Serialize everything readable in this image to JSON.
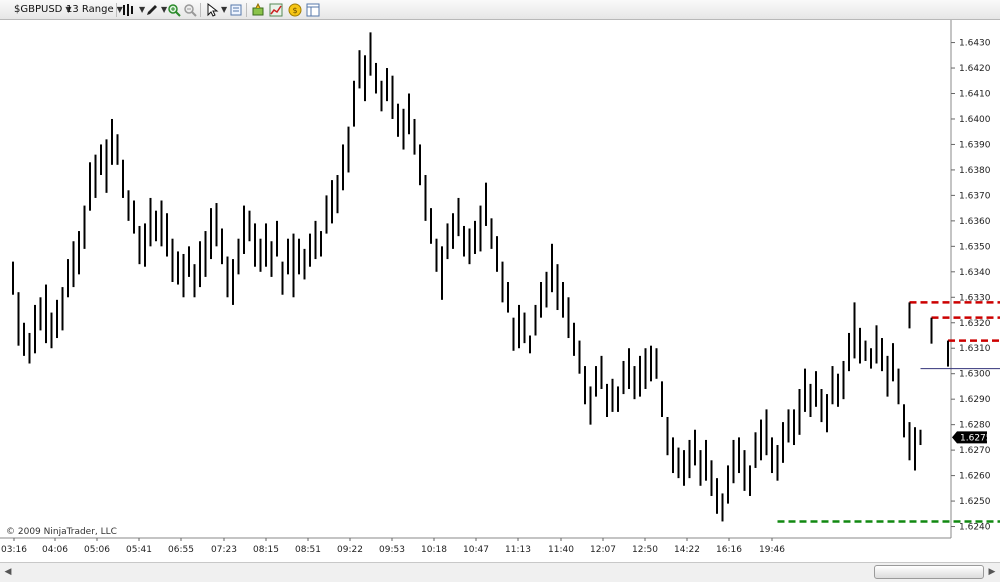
{
  "toolbar": {
    "instrument": "$GBPUSD",
    "period": "13 Range",
    "icons": [
      "bar-style-icon",
      "drawing-pencil-icon",
      "zoom-in-icon",
      "zoom-out-icon",
      "pointer-icon",
      "properties-icon",
      "strategy-icon",
      "chart-trader-icon",
      "alerts-icon",
      "data-box-icon"
    ]
  },
  "copyright": "© 2009 NinjaTrader, LLC",
  "colors": {
    "bars": "#000000",
    "resistance": "#cc0000",
    "support": "#118811",
    "pivot": "#33337a",
    "price_marker_bg": "#000000",
    "price_marker_text": "#ffffff"
  },
  "chart_data": {
    "type": "ohlc",
    "xlabels": [
      "03:16",
      "04:06",
      "05:06",
      "05:41",
      "06:55",
      "07:23",
      "08:15",
      "08:51",
      "09:22",
      "09:53",
      "10:18",
      "10:47",
      "11:13",
      "11:40",
      "12:07",
      "12:50",
      "14:22",
      "16:16",
      "19:46"
    ],
    "yticks": [
      1.624,
      1.625,
      1.626,
      1.627,
      1.628,
      1.629,
      1.63,
      1.631,
      1.632,
      1.633,
      1.634,
      1.635,
      1.636,
      1.637,
      1.638,
      1.639,
      1.64,
      1.641,
      1.642,
      1.643
    ],
    "ylim": [
      1.62355,
      1.64365
    ],
    "last_price": "1.6275",
    "bars": [
      {
        "h": 1.6344,
        "l": 1.6331
      },
      {
        "h": 1.6332,
        "l": 1.6311
      },
      {
        "h": 1.632,
        "l": 1.6307
      },
      {
        "h": 1.6316,
        "l": 1.6304
      },
      {
        "h": 1.6327,
        "l": 1.6308
      },
      {
        "h": 1.633,
        "l": 1.6317
      },
      {
        "h": 1.6335,
        "l": 1.6312
      },
      {
        "h": 1.6324,
        "l": 1.631
      },
      {
        "h": 1.6329,
        "l": 1.6314
      },
      {
        "h": 1.6334,
        "l": 1.6317
      },
      {
        "h": 1.6345,
        "l": 1.633
      },
      {
        "h": 1.6352,
        "l": 1.6334
      },
      {
        "h": 1.6356,
        "l": 1.6339
      },
      {
        "h": 1.6366,
        "l": 1.6349
      },
      {
        "h": 1.6383,
        "l": 1.6364
      },
      {
        "h": 1.6386,
        "l": 1.6369
      },
      {
        "h": 1.639,
        "l": 1.6378
      },
      {
        "h": 1.6392,
        "l": 1.6371
      },
      {
        "h": 1.64,
        "l": 1.6382
      },
      {
        "h": 1.6394,
        "l": 1.6382
      },
      {
        "h": 1.6384,
        "l": 1.6369
      },
      {
        "h": 1.6372,
        "l": 1.636
      },
      {
        "h": 1.6368,
        "l": 1.6355
      },
      {
        "h": 1.6358,
        "l": 1.6343
      },
      {
        "h": 1.6359,
        "l": 1.6342
      },
      {
        "h": 1.6369,
        "l": 1.635
      },
      {
        "h": 1.6364,
        "l": 1.6352
      },
      {
        "h": 1.6368,
        "l": 1.635
      },
      {
        "h": 1.6363,
        "l": 1.6346
      },
      {
        "h": 1.6353,
        "l": 1.6336
      },
      {
        "h": 1.6348,
        "l": 1.6335
      },
      {
        "h": 1.6347,
        "l": 1.633
      },
      {
        "h": 1.635,
        "l": 1.6338
      },
      {
        "h": 1.6343,
        "l": 1.633
      },
      {
        "h": 1.6352,
        "l": 1.6334
      },
      {
        "h": 1.6356,
        "l": 1.6338
      },
      {
        "h": 1.6365,
        "l": 1.6345
      },
      {
        "h": 1.6367,
        "l": 1.635
      },
      {
        "h": 1.6357,
        "l": 1.6343
      },
      {
        "h": 1.6346,
        "l": 1.633
      },
      {
        "h": 1.6345,
        "l": 1.6327
      },
      {
        "h": 1.6353,
        "l": 1.6339
      },
      {
        "h": 1.6366,
        "l": 1.6347
      },
      {
        "h": 1.6364,
        "l": 1.6352
      },
      {
        "h": 1.6359,
        "l": 1.6342
      },
      {
        "h": 1.6353,
        "l": 1.634
      },
      {
        "h": 1.6359,
        "l": 1.6342
      },
      {
        "h": 1.6352,
        "l": 1.6338
      },
      {
        "h": 1.636,
        "l": 1.6346
      },
      {
        "h": 1.6344,
        "l": 1.6331
      },
      {
        "h": 1.6353,
        "l": 1.6339
      },
      {
        "h": 1.6355,
        "l": 1.633
      },
      {
        "h": 1.6353,
        "l": 1.6339
      },
      {
        "h": 1.6349,
        "l": 1.6337
      },
      {
        "h": 1.6355,
        "l": 1.6342
      },
      {
        "h": 1.636,
        "l": 1.6345
      },
      {
        "h": 1.6356,
        "l": 1.6346
      },
      {
        "h": 1.637,
        "l": 1.6355
      },
      {
        "h": 1.6376,
        "l": 1.6359
      },
      {
        "h": 1.6378,
        "l": 1.6363
      },
      {
        "h": 1.639,
        "l": 1.6372
      },
      {
        "h": 1.6397,
        "l": 1.6379
      },
      {
        "h": 1.6415,
        "l": 1.6397
      },
      {
        "h": 1.6427,
        "l": 1.6412
      },
      {
        "h": 1.6425,
        "l": 1.6407
      },
      {
        "h": 1.6434,
        "l": 1.6417
      },
      {
        "h": 1.6422,
        "l": 1.641
      },
      {
        "h": 1.6415,
        "l": 1.6403
      },
      {
        "h": 1.642,
        "l": 1.6407
      },
      {
        "h": 1.6417,
        "l": 1.64
      },
      {
        "h": 1.6406,
        "l": 1.6393
      },
      {
        "h": 1.6404,
        "l": 1.6388
      },
      {
        "h": 1.641,
        "l": 1.6394
      },
      {
        "h": 1.64,
        "l": 1.6386
      },
      {
        "h": 1.639,
        "l": 1.6374
      },
      {
        "h": 1.6378,
        "l": 1.636
      },
      {
        "h": 1.6365,
        "l": 1.6351
      },
      {
        "h": 1.6353,
        "l": 1.634
      },
      {
        "h": 1.635,
        "l": 1.6329
      },
      {
        "h": 1.6359,
        "l": 1.6345
      },
      {
        "h": 1.6363,
        "l": 1.6349
      },
      {
        "h": 1.6369,
        "l": 1.6354
      },
      {
        "h": 1.6358,
        "l": 1.6346
      },
      {
        "h": 1.6357,
        "l": 1.6343
      },
      {
        "h": 1.636,
        "l": 1.6347
      },
      {
        "h": 1.6366,
        "l": 1.6348
      },
      {
        "h": 1.6375,
        "l": 1.6358
      },
      {
        "h": 1.6361,
        "l": 1.6349
      },
      {
        "h": 1.6354,
        "l": 1.634
      },
      {
        "h": 1.6344,
        "l": 1.6328
      },
      {
        "h": 1.6336,
        "l": 1.6324
      },
      {
        "h": 1.6322,
        "l": 1.6309
      },
      {
        "h": 1.6327,
        "l": 1.631
      },
      {
        "h": 1.6324,
        "l": 1.6312
      },
      {
        "h": 1.6315,
        "l": 1.6308
      },
      {
        "h": 1.6327,
        "l": 1.6315
      },
      {
        "h": 1.6336,
        "l": 1.6322
      },
      {
        "h": 1.634,
        "l": 1.6326
      },
      {
        "h": 1.6351,
        "l": 1.6332
      },
      {
        "h": 1.6343,
        "l": 1.6325
      },
      {
        "h": 1.6336,
        "l": 1.6322
      },
      {
        "h": 1.633,
        "l": 1.6314
      },
      {
        "h": 1.632,
        "l": 1.6307
      },
      {
        "h": 1.6313,
        "l": 1.63
      },
      {
        "h": 1.6303,
        "l": 1.6288
      },
      {
        "h": 1.6295,
        "l": 1.628
      },
      {
        "h": 1.6303,
        "l": 1.6291
      },
      {
        "h": 1.6307,
        "l": 1.6294
      },
      {
        "h": 1.6296,
        "l": 1.6283
      },
      {
        "h": 1.6298,
        "l": 1.6285
      },
      {
        "h": 1.6295,
        "l": 1.6285
      },
      {
        "h": 1.6305,
        "l": 1.6292
      },
      {
        "h": 1.631,
        "l": 1.6294
      },
      {
        "h": 1.6303,
        "l": 1.629
      },
      {
        "h": 1.6307,
        "l": 1.6291
      },
      {
        "h": 1.631,
        "l": 1.6294
      },
      {
        "h": 1.6311,
        "l": 1.6297
      },
      {
        "h": 1.631,
        "l": 1.6298
      },
      {
        "h": 1.6297,
        "l": 1.6283
      },
      {
        "h": 1.6283,
        "l": 1.6268
      },
      {
        "h": 1.6275,
        "l": 1.6261
      },
      {
        "h": 1.6271,
        "l": 1.6259
      },
      {
        "h": 1.627,
        "l": 1.6256
      },
      {
        "h": 1.6274,
        "l": 1.6259
      },
      {
        "h": 1.6278,
        "l": 1.6264
      },
      {
        "h": 1.627,
        "l": 1.6256
      },
      {
        "h": 1.6274,
        "l": 1.6258
      },
      {
        "h": 1.6266,
        "l": 1.6252
      },
      {
        "h": 1.6259,
        "l": 1.6245
      },
      {
        "h": 1.6253,
        "l": 1.6242
      },
      {
        "h": 1.6264,
        "l": 1.6249
      },
      {
        "h": 1.6274,
        "l": 1.6257
      },
      {
        "h": 1.6275,
        "l": 1.6261
      },
      {
        "h": 1.627,
        "l": 1.6254
      },
      {
        "h": 1.6264,
        "l": 1.6252
      },
      {
        "h": 1.6277,
        "l": 1.6263
      },
      {
        "h": 1.6282,
        "l": 1.6266
      },
      {
        "h": 1.6286,
        "l": 1.6268
      },
      {
        "h": 1.6275,
        "l": 1.6261
      },
      {
        "h": 1.6272,
        "l": 1.6258
      },
      {
        "h": 1.6281,
        "l": 1.6265
      },
      {
        "h": 1.6286,
        "l": 1.6273
      },
      {
        "h": 1.6286,
        "l": 1.6272
      },
      {
        "h": 1.6294,
        "l": 1.6276
      },
      {
        "h": 1.6302,
        "l": 1.6285
      },
      {
        "h": 1.6296,
        "l": 1.6283
      },
      {
        "h": 1.6301,
        "l": 1.6287
      },
      {
        "h": 1.6294,
        "l": 1.6281
      },
      {
        "h": 1.6292,
        "l": 1.6277
      },
      {
        "h": 1.6303,
        "l": 1.6288
      },
      {
        "h": 1.63,
        "l": 1.6287
      },
      {
        "h": 1.6305,
        "l": 1.629
      },
      {
        "h": 1.6316,
        "l": 1.6301
      },
      {
        "h": 1.6328,
        "l": 1.6306
      },
      {
        "h": 1.6318,
        "l": 1.6304
      },
      {
        "h": 1.6313,
        "l": 1.6305
      },
      {
        "h": 1.631,
        "l": 1.6302
      },
      {
        "h": 1.6319,
        "l": 1.6304
      },
      {
        "h": 1.6314,
        "l": 1.6301
      },
      {
        "h": 1.6307,
        "l": 1.6291
      },
      {
        "h": 1.6312,
        "l": 1.6297
      },
      {
        "h": 1.6302,
        "l": 1.6288
      },
      {
        "h": 1.6288,
        "l": 1.6275
      },
      {
        "h": 1.6281,
        "l": 1.6266
      },
      {
        "h": 1.6279,
        "l": 1.6262
      },
      {
        "h": 1.6278,
        "l": 1.6272
      }
    ],
    "levels": [
      {
        "kind": "resistance",
        "price": 1.6328,
        "start_bar": 163,
        "end_bar": 186
      },
      {
        "kind": "resistance",
        "price": 1.6322,
        "start_bar": 167,
        "end_bar": 191
      },
      {
        "kind": "resistance",
        "price": 1.6313,
        "start_bar": 170,
        "end_bar": 195
      },
      {
        "kind": "pivot",
        "price": 1.6302,
        "start_bar": 165,
        "end_bar": 189
      },
      {
        "kind": "support",
        "price": 1.6242,
        "start_bar": 139,
        "end_bar": 204
      }
    ]
  }
}
